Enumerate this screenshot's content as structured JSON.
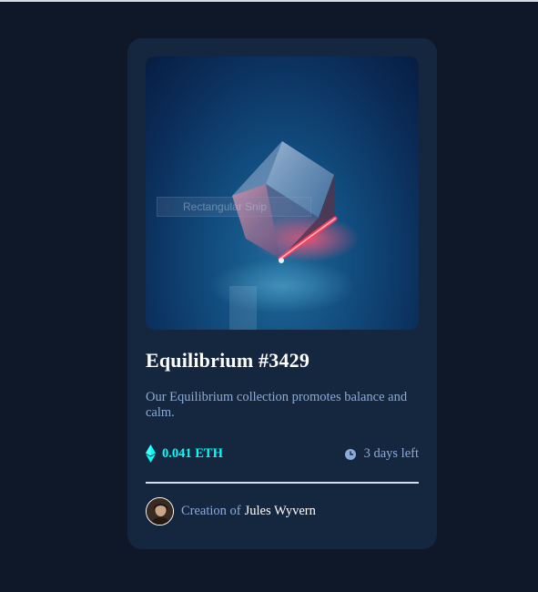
{
  "card": {
    "title": "Equilibrium #3429",
    "description": "Our Equilibrium collection promotes balance and calm.",
    "price": "0.041 ETH",
    "time_left": "3 days left",
    "creation_prefix": "Creation of",
    "creator_name": "Jules Wyvern"
  },
  "overlay": {
    "snip_label": "Rectangular Snip"
  },
  "icons": {
    "price": "ethereum-icon",
    "time": "clock-icon"
  },
  "colors": {
    "page_background": "#0e1829",
    "card_background": "#15263f",
    "accent_cyan": "#00fff8",
    "soft_blue": "#8bacd9",
    "white": "#ffffff"
  }
}
